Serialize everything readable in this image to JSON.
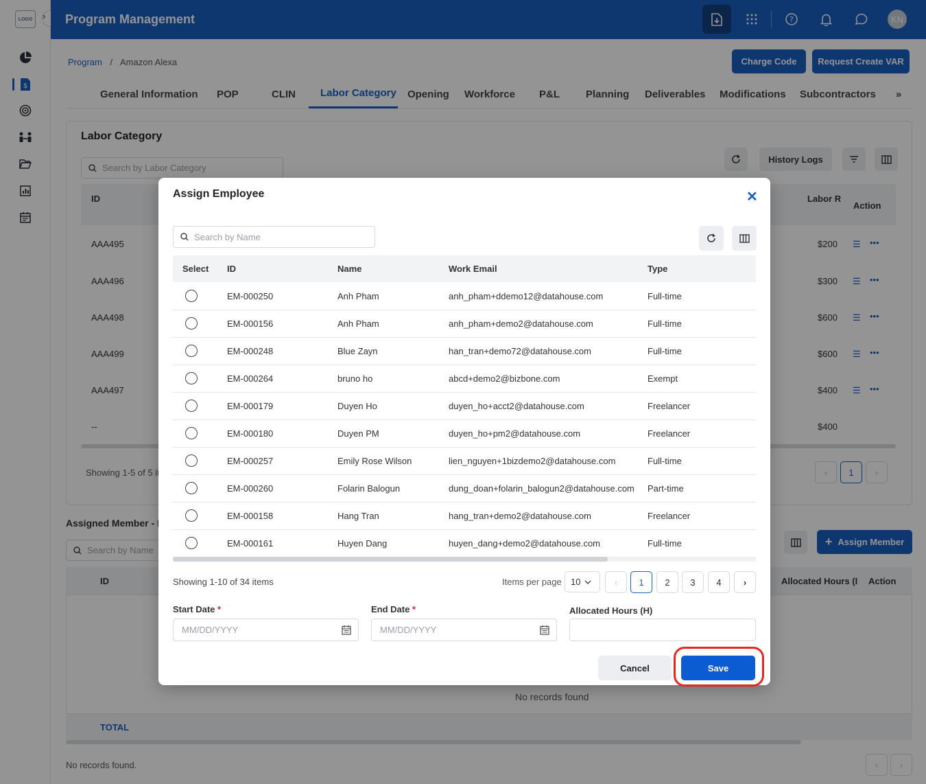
{
  "app": {
    "title": "Program Management",
    "logo_text": "LOGO",
    "user_initials": "KN"
  },
  "breadcrumb": {
    "root": "Program",
    "separator": "/",
    "current": "Amazon Alexa"
  },
  "header_buttons": {
    "charge_code": "Charge Code",
    "request_var": "Request Create VAR"
  },
  "tabs": [
    "General Information",
    "POP",
    "CLIN",
    "Labor Category",
    "Opening",
    "Workforce",
    "P&L",
    "Planning",
    "Deliverables",
    "Modifications",
    "Subcontractors"
  ],
  "tabs_more": "»",
  "labor_category": {
    "title": "Labor Category",
    "search_placeholder": "Search by Labor Category",
    "history_logs": "History Logs",
    "col_id": "ID",
    "col_labor_rate": "Labor R",
    "col_action": "Action",
    "rows": [
      {
        "id": "AAA495",
        "rate": "$200"
      },
      {
        "id": "AAA496",
        "rate": "$300"
      },
      {
        "id": "AAA498",
        "rate": "$600"
      },
      {
        "id": "AAA499",
        "rate": "$600"
      },
      {
        "id": "AAA497",
        "rate": "$400"
      },
      {
        "id": "--",
        "rate": "$400"
      }
    ],
    "showing": "Showing 1-5 of 5 it",
    "page": "1"
  },
  "assigned_member": {
    "title": "Assigned Member - L",
    "search_placeholder": "Search by Name",
    "assign_button": "Assign Member",
    "col_id": "ID",
    "col_alloc": "Allocated Hours (I",
    "col_action": "Action",
    "empty": "No records found",
    "total": "TOTAL",
    "footer": "No records found."
  },
  "modal": {
    "title": "Assign Employee",
    "search_placeholder": "Search by Name",
    "columns": {
      "select": "Select",
      "id": "ID",
      "name": "Name",
      "email": "Work Email",
      "type": "Type"
    },
    "rows": [
      {
        "id": "EM-000250",
        "name": "Anh Pham",
        "email": "anh_pham+ddemo12@datahouse.com",
        "type": "Full-time"
      },
      {
        "id": "EM-000156",
        "name": "Anh Pham",
        "email": "anh_pham+demo2@datahouse.com",
        "type": "Full-time"
      },
      {
        "id": "EM-000248",
        "name": "Blue Zayn",
        "email": "han_tran+demo72@datahouse.com",
        "type": "Full-time"
      },
      {
        "id": "EM-000264",
        "name": "bruno ho",
        "email": "abcd+demo2@bizbone.com",
        "type": "Exempt"
      },
      {
        "id": "EM-000179",
        "name": "Duyen Ho",
        "email": "duyen_ho+acct2@datahouse.com",
        "type": "Freelancer"
      },
      {
        "id": "EM-000180",
        "name": "Duyen PM",
        "email": "duyen_ho+pm2@datahouse.com",
        "type": "Freelancer"
      },
      {
        "id": "EM-000257",
        "name": "Emily Rose Wilson",
        "email": "lien_nguyen+1bizdemo2@datahouse.com",
        "type": "Full-time"
      },
      {
        "id": "EM-000260",
        "name": "Folarin Balogun",
        "email": "dung_doan+folarin_balogun2@datahouse.com",
        "type": "Part-time"
      },
      {
        "id": "EM-000158",
        "name": "Hang Tran",
        "email": "hang_tran+demo2@datahouse.com",
        "type": "Freelancer"
      },
      {
        "id": "EM-000161",
        "name": "Huyen Dang",
        "email": "huyen_dang+demo2@datahouse.com",
        "type": "Full-time"
      }
    ],
    "pagination": {
      "showing": "Showing 1-10 of 34 items",
      "items_per_page_label": "Items per page",
      "items_per_page": "10",
      "pages": [
        "1",
        "2",
        "3",
        "4"
      ],
      "current_page": "1"
    },
    "fields": {
      "start_date_label": "Start Date",
      "end_date_label": "End Date",
      "required_mark": "*",
      "allocated_label": "Allocated Hours (H)",
      "date_placeholder": "MM/DD/YYYY",
      "allocated_value": ""
    },
    "cancel": "Cancel",
    "save": "Save"
  },
  "colors": {
    "primary": "#1b5fbf",
    "save": "#0b5bd3",
    "highlight": "#e8271e"
  }
}
